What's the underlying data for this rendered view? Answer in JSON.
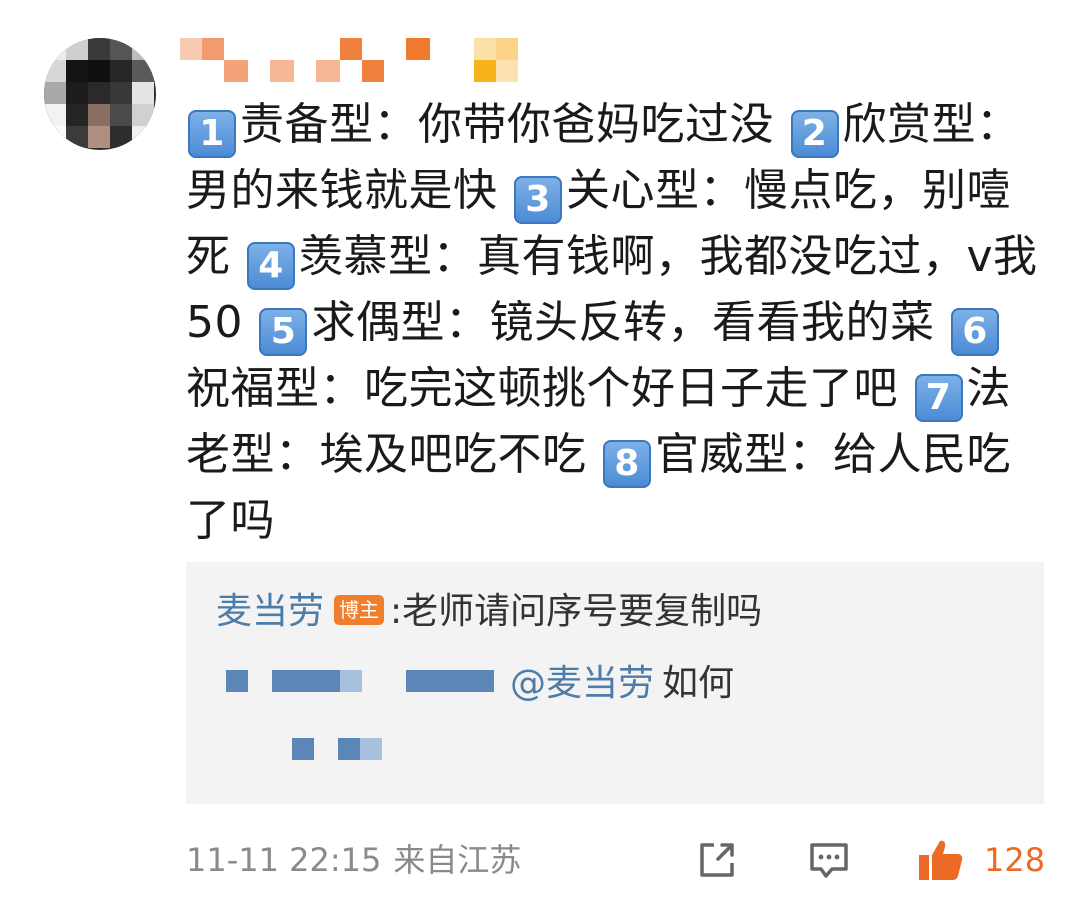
{
  "comment": {
    "items": [
      {
        "num": "1",
        "text": "责备型：你带你爸妈吃过没 "
      },
      {
        "num": "2",
        "text": "欣赏型：男的来钱就是快 "
      },
      {
        "num": "3",
        "text": "关心型：慢点吃，别噎死 "
      },
      {
        "num": "4",
        "text": "羡慕型：真有钱啊，我都没吃过，v我50 "
      },
      {
        "num": "5",
        "text": "求偶型：镜头反转，看看我的菜 "
      },
      {
        "num": "6",
        "text": "祝福型：吃完这顿挑个好日子走了吧 "
      },
      {
        "num": "7",
        "text": "法老型：埃及吧吃不吃 "
      },
      {
        "num": "8",
        "text": "官威型：给人民吃了吗"
      }
    ]
  },
  "reply": {
    "author": "麦当劳",
    "badge": "博主",
    "text": ":老师请问序号要复制吗",
    "mention": "@麦当劳",
    "mention_tail": "如何"
  },
  "footer": {
    "time": "11-11 22:15",
    "location": "来自江苏",
    "like_count": "128"
  },
  "colors": {
    "link": "#4d7ca8",
    "badge": "#f07e2b",
    "like": "#ea6a26",
    "meta": "#8a8a8a"
  },
  "icons": {
    "share": "share-icon",
    "reply": "comment-icon",
    "like": "thumbs-up-icon"
  }
}
